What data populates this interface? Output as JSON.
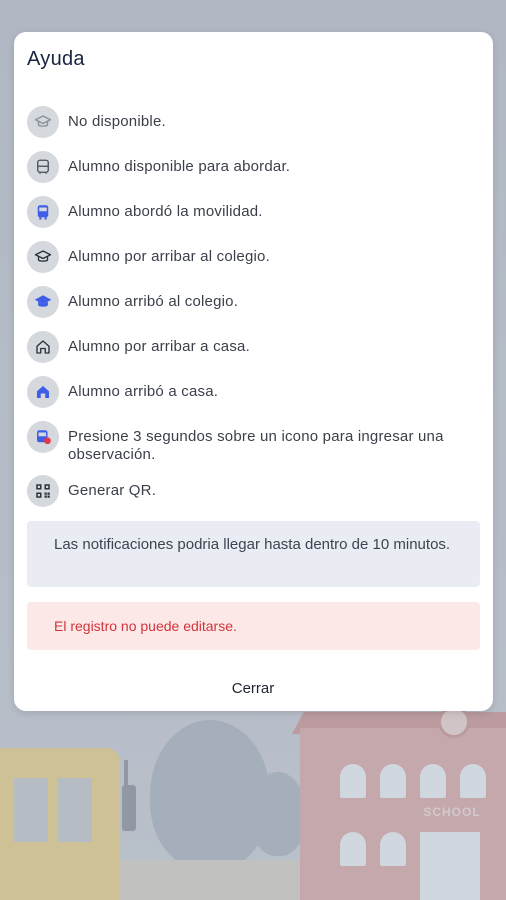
{
  "dialog": {
    "title": "Ayuda",
    "items": [
      {
        "icon": "graduation-cap-outline-icon",
        "label": "No disponible."
      },
      {
        "icon": "bus-outline-icon",
        "label": "Alumno disponible para abordar."
      },
      {
        "icon": "bus-filled-icon",
        "label": "Alumno abordó la movilidad."
      },
      {
        "icon": "graduation-cap-outline-icon",
        "label": "Alumno por arribar al colegio."
      },
      {
        "icon": "graduation-cap-filled-icon",
        "label": "Alumno arribó al colegio."
      },
      {
        "icon": "home-outline-icon",
        "label": "Alumno por arribar a casa."
      },
      {
        "icon": "home-filled-icon",
        "label": "Alumno arribó a casa."
      },
      {
        "icon": "bus-observation-icon",
        "label": "Presione 3 segundos sobre un icono para ingresar una observación."
      },
      {
        "icon": "qr-code-icon",
        "label": "Generar QR."
      }
    ],
    "info_text": "Las notificaciones podria llegar hasta dentro de 10 minutos.",
    "warning_text": "El registro no puede editarse.",
    "close_label": "Cerrar"
  },
  "background": {
    "school_sign": "SCHOOL"
  },
  "colors": {
    "accent_blue": "#3e5ee8",
    "alert_red": "#e53945",
    "warning_bg": "#fde8e8",
    "info_bg": "#e9edf3",
    "icon_bg": "#d5d8dd"
  }
}
